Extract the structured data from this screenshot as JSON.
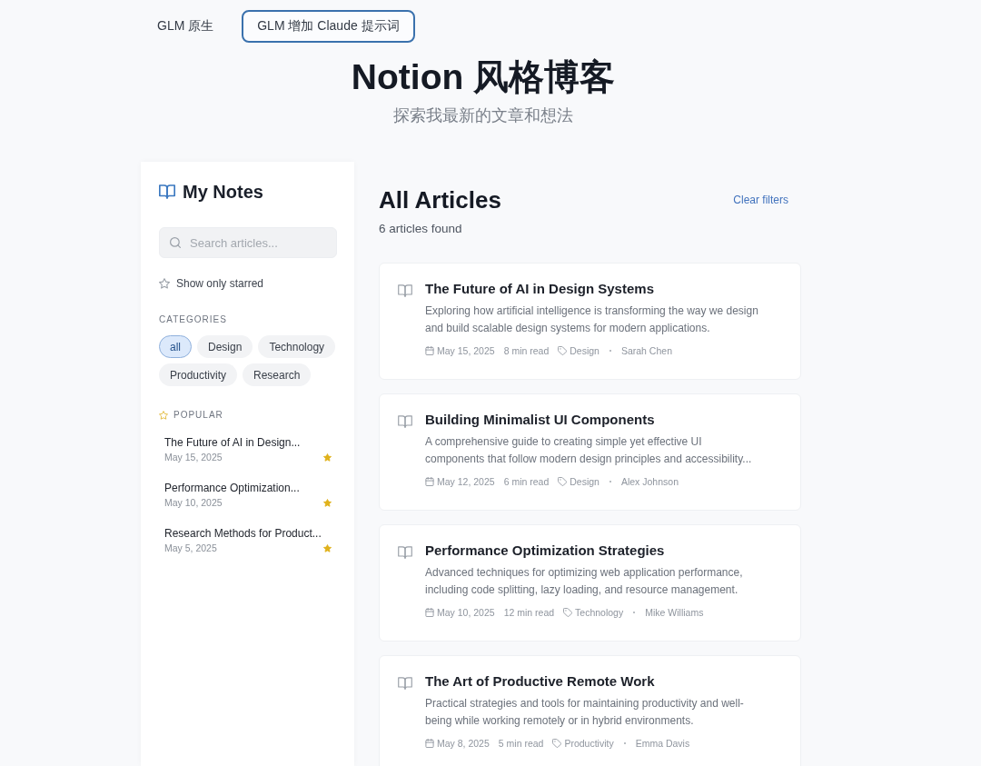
{
  "tabs": [
    {
      "label": "GLM 原生",
      "selected": false
    },
    {
      "label": "GLM 增加 Claude 提示词",
      "selected": true
    }
  ],
  "header": {
    "title": "Notion 风格博客",
    "subtitle": "探索我最新的文章和想法"
  },
  "sidebar": {
    "title": "My Notes",
    "search": {
      "placeholder": "Search articles..."
    },
    "starred_filter": {
      "label": "Show only starred",
      "checked": false
    },
    "categories_heading": "CATEGORIES",
    "categories": [
      {
        "label": "all",
        "selected": true
      },
      {
        "label": "Design",
        "selected": false
      },
      {
        "label": "Technology",
        "selected": false
      },
      {
        "label": "Productivity",
        "selected": false
      },
      {
        "label": "Research",
        "selected": false
      }
    ],
    "popular_heading": "POPULAR",
    "popular": [
      {
        "title": "The Future of AI in Design...",
        "date": "May 15, 2025",
        "starred": true
      },
      {
        "title": "Performance Optimization...",
        "date": "May 10, 2025",
        "starred": true
      },
      {
        "title": "Research Methods for Product...",
        "date": "May 5, 2025",
        "starred": true
      }
    ]
  },
  "main": {
    "title": "All Articles",
    "clear_filters": "Clear filters",
    "count": "6 articles found",
    "articles": [
      {
        "title": "The Future of AI in Design Systems",
        "excerpt": "Exploring how artificial intelligence is transforming the way we design and build scalable design systems for modern applications.",
        "date": "May 15, 2025",
        "read_time": "8 min read",
        "category": "Design",
        "author": "Sarah Chen"
      },
      {
        "title": "Building Minimalist UI Components",
        "excerpt": "A comprehensive guide to creating simple yet effective UI components that follow modern design principles and accessibility...",
        "date": "May 12, 2025",
        "read_time": "6 min read",
        "category": "Design",
        "author": "Alex Johnson"
      },
      {
        "title": "Performance Optimization Strategies",
        "excerpt": "Advanced techniques for optimizing web application performance, including code splitting, lazy loading, and resource management.",
        "date": "May 10, 2025",
        "read_time": "12 min read",
        "category": "Technology",
        "author": "Mike Williams"
      },
      {
        "title": "The Art of Productive Remote Work",
        "excerpt": "Practical strategies and tools for maintaining productivity and well-being while working remotely or in hybrid environments.",
        "date": "May 8, 2025",
        "read_time": "5 min read",
        "category": "Productivity",
        "author": "Emma Davis"
      }
    ]
  }
}
